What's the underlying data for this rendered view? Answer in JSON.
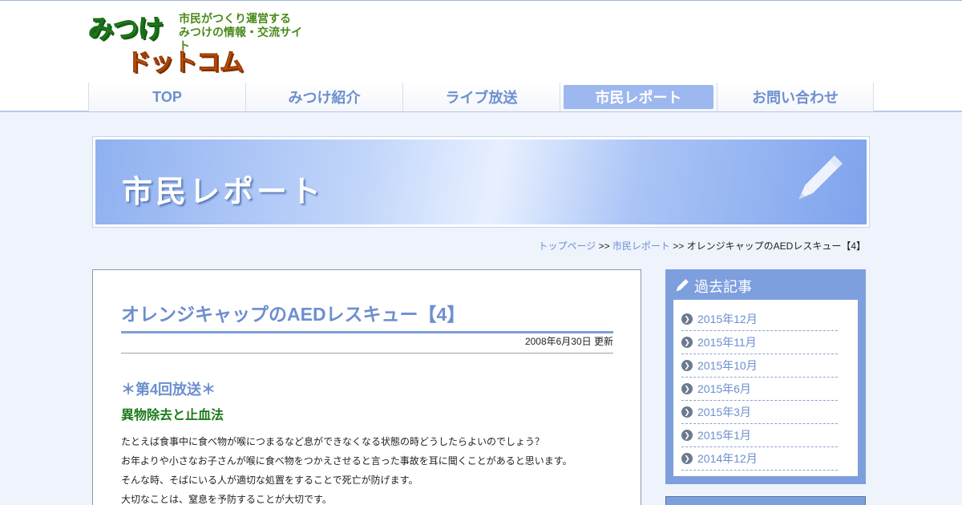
{
  "logo": {
    "top": "みつけ",
    "bottom": "ドットコム",
    "tagline": "市民がつくり運営する\nみつけの情報・交流サイト"
  },
  "nav": [
    {
      "label": "TOP",
      "active": false
    },
    {
      "label": "みつけ紹介",
      "active": false
    },
    {
      "label": "ライブ放送",
      "active": false
    },
    {
      "label": "市民レポート",
      "active": true
    },
    {
      "label": "お問い合わせ",
      "active": false
    }
  ],
  "banner": {
    "title": "市民レポート",
    "icon": "pencil-icon"
  },
  "breadcrumb": {
    "home": "トップページ",
    "sep1": ">>",
    "section": "市民レポート",
    "sep2": ">>",
    "current": "オレンジキャップのAEDレスキュー【4】"
  },
  "article": {
    "title": "オレンジキャップのAEDレスキュー【4】",
    "date": "2008年6月30日 更新",
    "section_title": "＊第4回放送＊",
    "sub_title": "異物除去と止血法",
    "paragraphs": [
      "たとえば食事中に食べ物が喉につまるなど息ができなくなる状態の時どうしたらよいのでしょう？",
      "お年よりや小さなお子さんが喉に食べ物をつかえさせると言った事故を耳に聞くことがあると思います。",
      "そんな時、そばにいる人が適切な処置をすることで死亡が防げます。",
      "大切なことは、窒息を予防することが大切です。"
    ]
  },
  "sidebar": {
    "title": "過去記事",
    "items": [
      "2015年12月",
      "2015年11月",
      "2015年10月",
      "2015年6月",
      "2015年3月",
      "2015年1月",
      "2014年12月"
    ]
  },
  "colors": {
    "accent": "#6d8fcf",
    "sidebar": "#7e9fde",
    "green": "#1a7a1a"
  }
}
